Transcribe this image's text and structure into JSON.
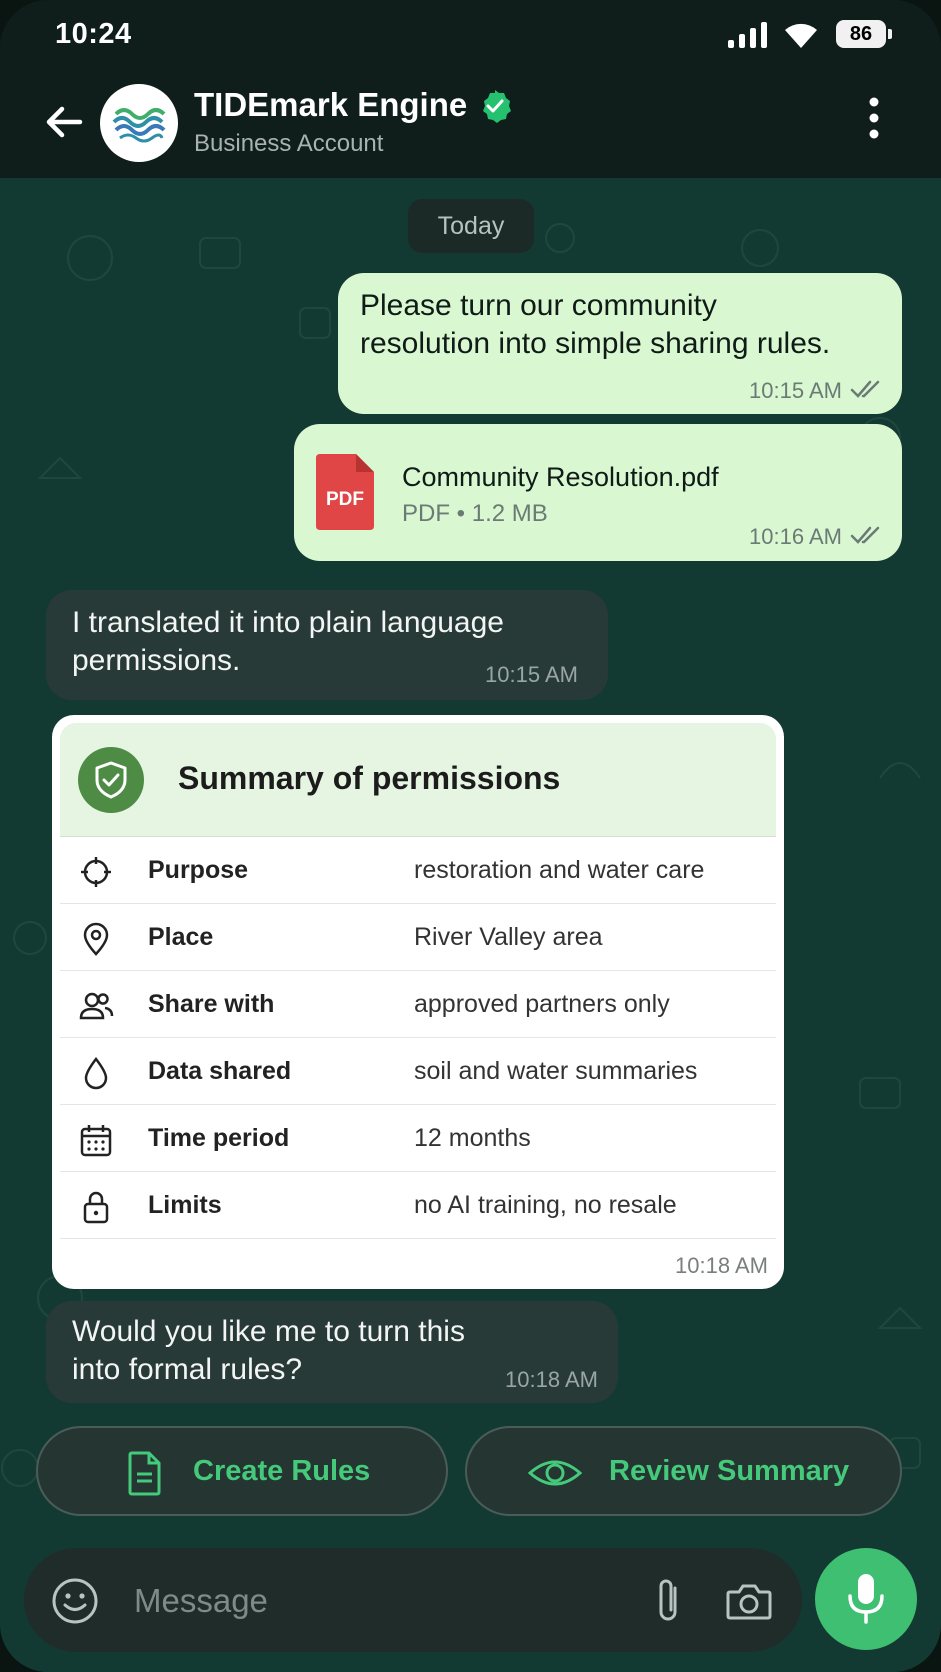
{
  "status_bar": {
    "time": "10:24",
    "battery": "86"
  },
  "header": {
    "title": "TIDEmark Engine",
    "subtitle": "Business Account"
  },
  "date_chip": "Today",
  "messages": {
    "out1": {
      "text_line1": "Please turn our community",
      "text_line2": "resolution into simple sharing rules.",
      "time": "10:15 AM"
    },
    "file": {
      "icon_label": "PDF",
      "name": "Community Resolution.pdf",
      "info": "PDF • 1.2 MB",
      "time": "10:16 AM"
    },
    "in1": {
      "text_line1": "I translated it into plain language",
      "text_line2": "permissions.",
      "time": "10:15 AM"
    },
    "card": {
      "title": "Summary of permissions",
      "rows": [
        {
          "icon": "target-icon",
          "label": "Purpose",
          "value": "restoration and water care"
        },
        {
          "icon": "location-pin-icon",
          "label": "Place",
          "value": "River Valley area"
        },
        {
          "icon": "people-icon",
          "label": "Share with",
          "value": "approved partners only"
        },
        {
          "icon": "water-drop-icon",
          "label": "Data shared",
          "value": "soil and water summaries"
        },
        {
          "icon": "calendar-icon",
          "label": "Time period",
          "value": "12 months"
        },
        {
          "icon": "lock-icon",
          "label": "Limits",
          "value": "no AI training, no resale"
        }
      ],
      "time": "10:18 AM"
    },
    "in2": {
      "text_line1": "Would you like me to turn this",
      "text_line2": "into formal rules?",
      "time": "10:18 AM"
    }
  },
  "actions": {
    "create_rules": "Create Rules",
    "review_summary": "Review Summary"
  },
  "composer": {
    "placeholder": "Message"
  },
  "colors": {
    "accent": "#45c97a",
    "outgoing_bubble": "#d9f8d1",
    "incoming_bubble": "#283a37",
    "card_header": "#e6f4e2",
    "shield": "#4e8b44",
    "pdf_red": "#e04646"
  }
}
